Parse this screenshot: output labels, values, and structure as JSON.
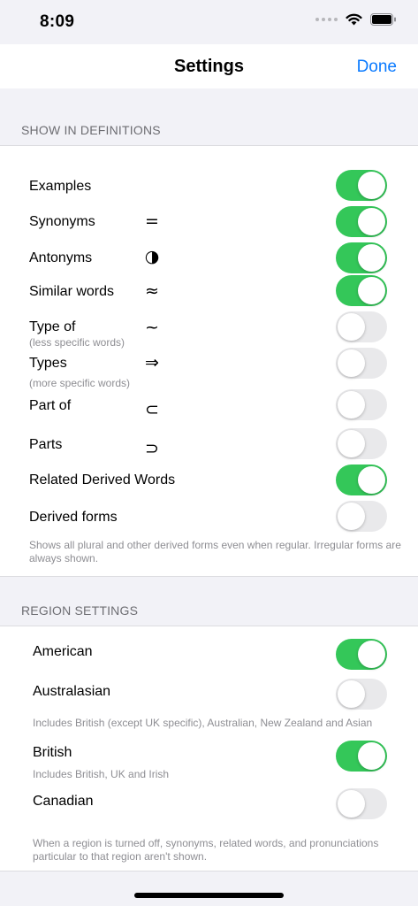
{
  "status_bar": {
    "time": "8:09"
  },
  "nav": {
    "title": "Settings",
    "done_label": "Done"
  },
  "definitions": {
    "header": "SHOW IN DEFINITIONS",
    "items": [
      {
        "label": "Examples",
        "sublabel": "",
        "symbol": "",
        "on": true
      },
      {
        "label": "Synonyms",
        "sublabel": "",
        "symbol": "=",
        "on": true
      },
      {
        "label": "Antonyms",
        "sublabel": "",
        "symbol": "◑",
        "on": true
      },
      {
        "label": "Similar words",
        "sublabel": "",
        "symbol": "≈",
        "on": true
      },
      {
        "label": "Type of",
        "sublabel": "(less specific words)",
        "symbol": "~",
        "on": false
      },
      {
        "label": "Types",
        "sublabel": "(more specific words)",
        "symbol": "⇒",
        "on": false
      },
      {
        "label": "Part of",
        "sublabel": "",
        "symbol": "⊂",
        "on": false
      },
      {
        "label": "Parts",
        "sublabel": "",
        "symbol": "⊃",
        "on": false
      },
      {
        "label": "Related Derived Words",
        "sublabel": "",
        "symbol": "",
        "on": true
      },
      {
        "label": "Derived forms",
        "sublabel": "",
        "symbol": "",
        "on": false
      }
    ],
    "footnote": "Shows all plural and other derived forms even when regular. Irregular forms are always shown."
  },
  "regions": {
    "header": "REGION SETTINGS",
    "items": [
      {
        "label": "American",
        "sublabel": "",
        "on": true
      },
      {
        "label": "Australasian",
        "sublabel": "Includes British (except UK specific), Australian, New Zealand and Asian",
        "on": false
      },
      {
        "label": "British",
        "sublabel": "Includes British, UK and Irish",
        "on": true
      },
      {
        "label": "Canadian",
        "sublabel": "",
        "on": false
      }
    ],
    "footnote": "When a region is turned off, synonyms, related words, and pronunciations particular to that region aren't shown."
  },
  "colors": {
    "accent": "#0a7aff",
    "toggle_on": "#34c759",
    "toggle_off": "#e9e9eb"
  }
}
